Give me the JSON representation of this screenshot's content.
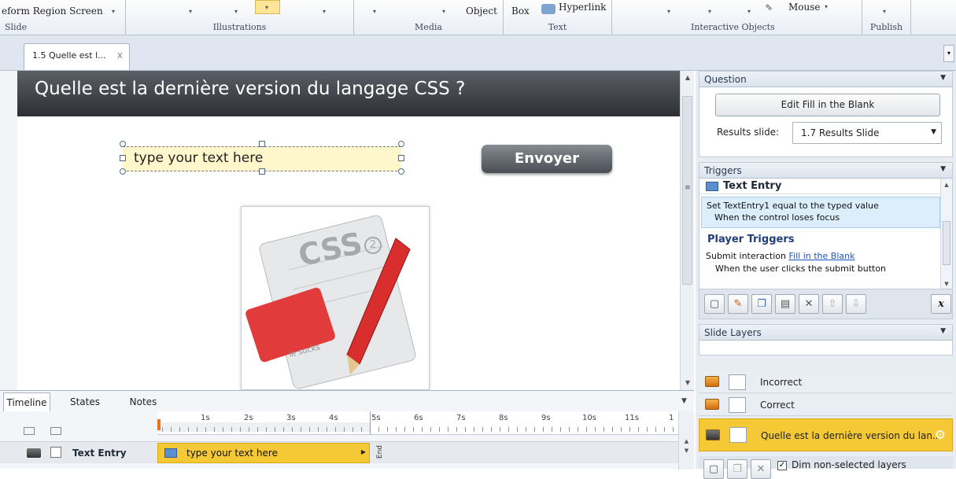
{
  "ribbon": {
    "row1": {
      "freeform": "eform Region Screen",
      "object": "Object",
      "box": "Box",
      "hyperlink": "Hyperlink",
      "mouse": "Mouse"
    },
    "groups": [
      "Slide",
      "Illustrations",
      "Media",
      "Text",
      "Interactive Objects",
      "Publish"
    ]
  },
  "doc_tab": {
    "label": "1.5 Quelle est l...",
    "close": "x"
  },
  "slide": {
    "title": "Quelle est la dernière version du langage CSS ?",
    "text_entry_placeholder": "type your text here",
    "submit_label": "Envoyer",
    "image_text": {
      "css": "CSS",
      "badge": "2",
      "note": "ie sucks"
    }
  },
  "question_panel": {
    "header": "Question",
    "edit_button": "Edit Fill in the Blank",
    "results_label": "Results slide:",
    "results_value": "1.7 Results Slide"
  },
  "triggers_panel": {
    "header": "Triggers",
    "group1_title": "Text Entry",
    "trigger1_line1": "Set TextEntry1 equal to the typed value",
    "trigger1_line2": "When the control loses focus",
    "group2_title": "Player Triggers",
    "trigger2_prefix": "Submit interaction ",
    "trigger2_link": "Fill in the Blank",
    "trigger2_line2": "When the user clicks the submit button",
    "var_button": "x"
  },
  "layers_panel": {
    "header": "Slide Layers",
    "layers": [
      "Incorrect",
      "Correct",
      "Quelle est la dernière version du lan..."
    ],
    "dim_label": "Dim non-selected layers"
  },
  "timeline": {
    "tabs": [
      "Timeline",
      "States",
      "Notes"
    ],
    "ticks": [
      "1s",
      "2s",
      "3s",
      "4s",
      "5s",
      "6s",
      "7s",
      "8s",
      "9s",
      "10s",
      "11s",
      "1"
    ],
    "row_label": "Text Entry",
    "bar_label": "type your text here",
    "end_label": "End"
  },
  "colors": {
    "accent_yellow": "#f5c936",
    "title_bar": "#3b3e44",
    "selection": "#dceefb"
  }
}
